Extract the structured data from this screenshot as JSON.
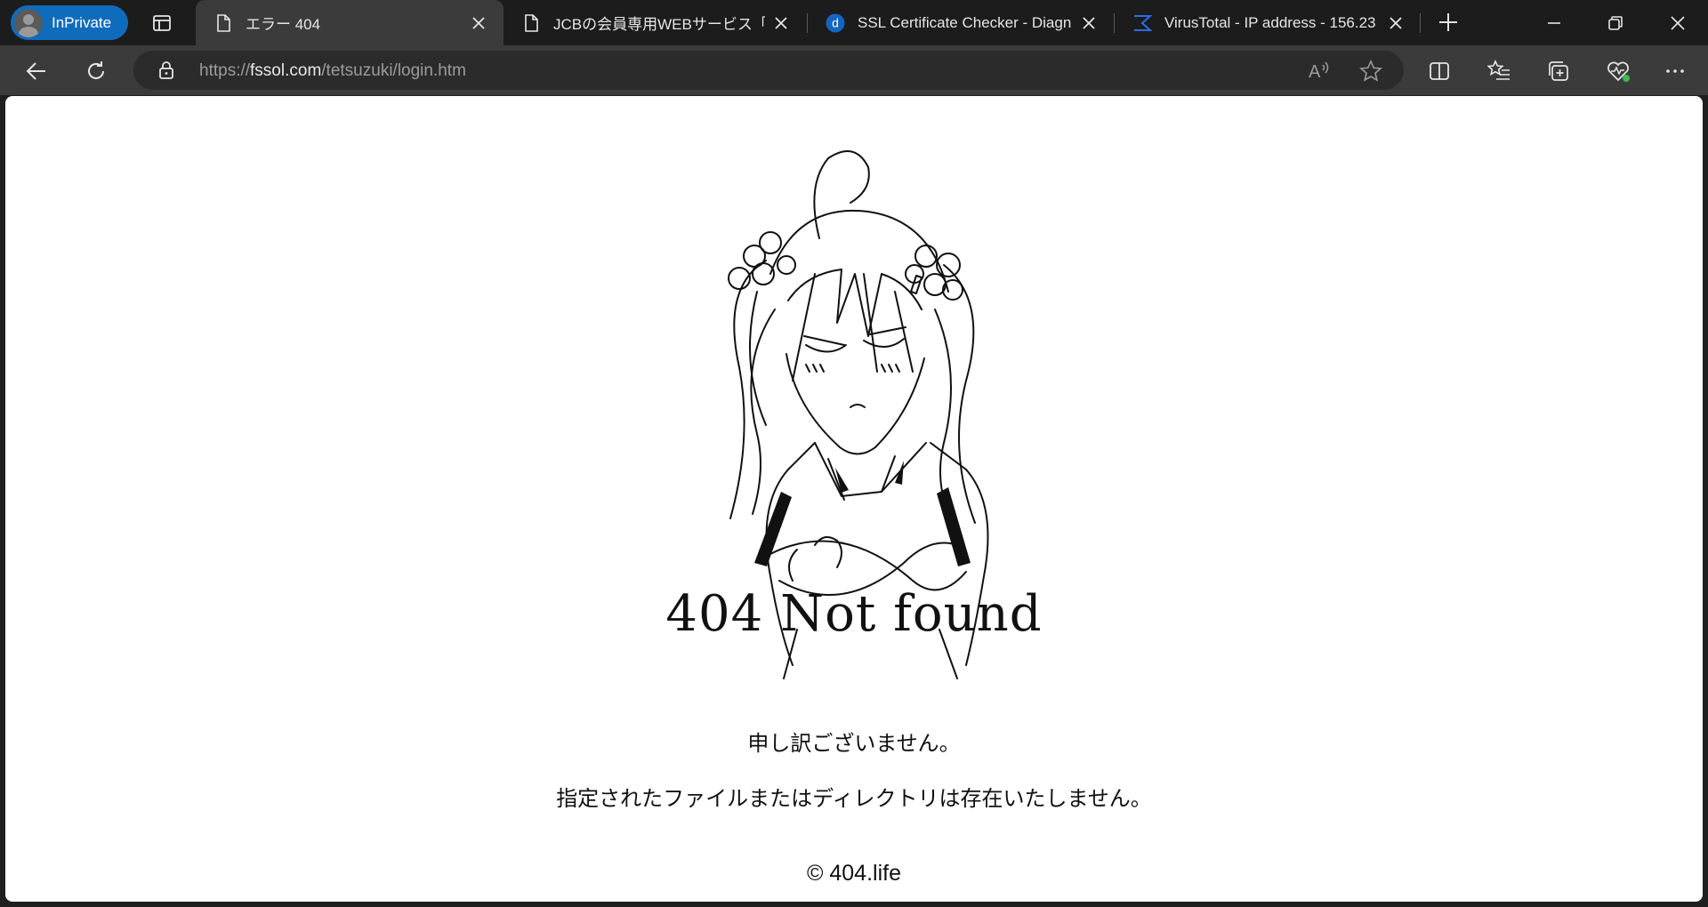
{
  "browser": {
    "profile_label": "InPrivate",
    "tabs": [
      {
        "title": "エラー 404",
        "favicon": "page-icon",
        "active": true
      },
      {
        "title": "JCBの会員専用WEBサービス「MyJ",
        "favicon": "page-icon",
        "active": false
      },
      {
        "title": "SSL Certificate Checker - Diagn",
        "favicon": "digicert-d-icon",
        "active": false
      },
      {
        "title": "VirusTotal - IP address - 156.23",
        "favicon": "virustotal-icon",
        "active": false
      }
    ],
    "address": {
      "scheme": "https://",
      "host": "fssol.com",
      "path": "/tetsuzuki/login.htm"
    },
    "accent_color": "#0f6cbd"
  },
  "page": {
    "headline": "404 Not found",
    "message_1": "申し訳ございません。",
    "message_2": "指定されたファイルまたはディレクトリは存在いたしません。",
    "copyright": "© 404.life"
  }
}
